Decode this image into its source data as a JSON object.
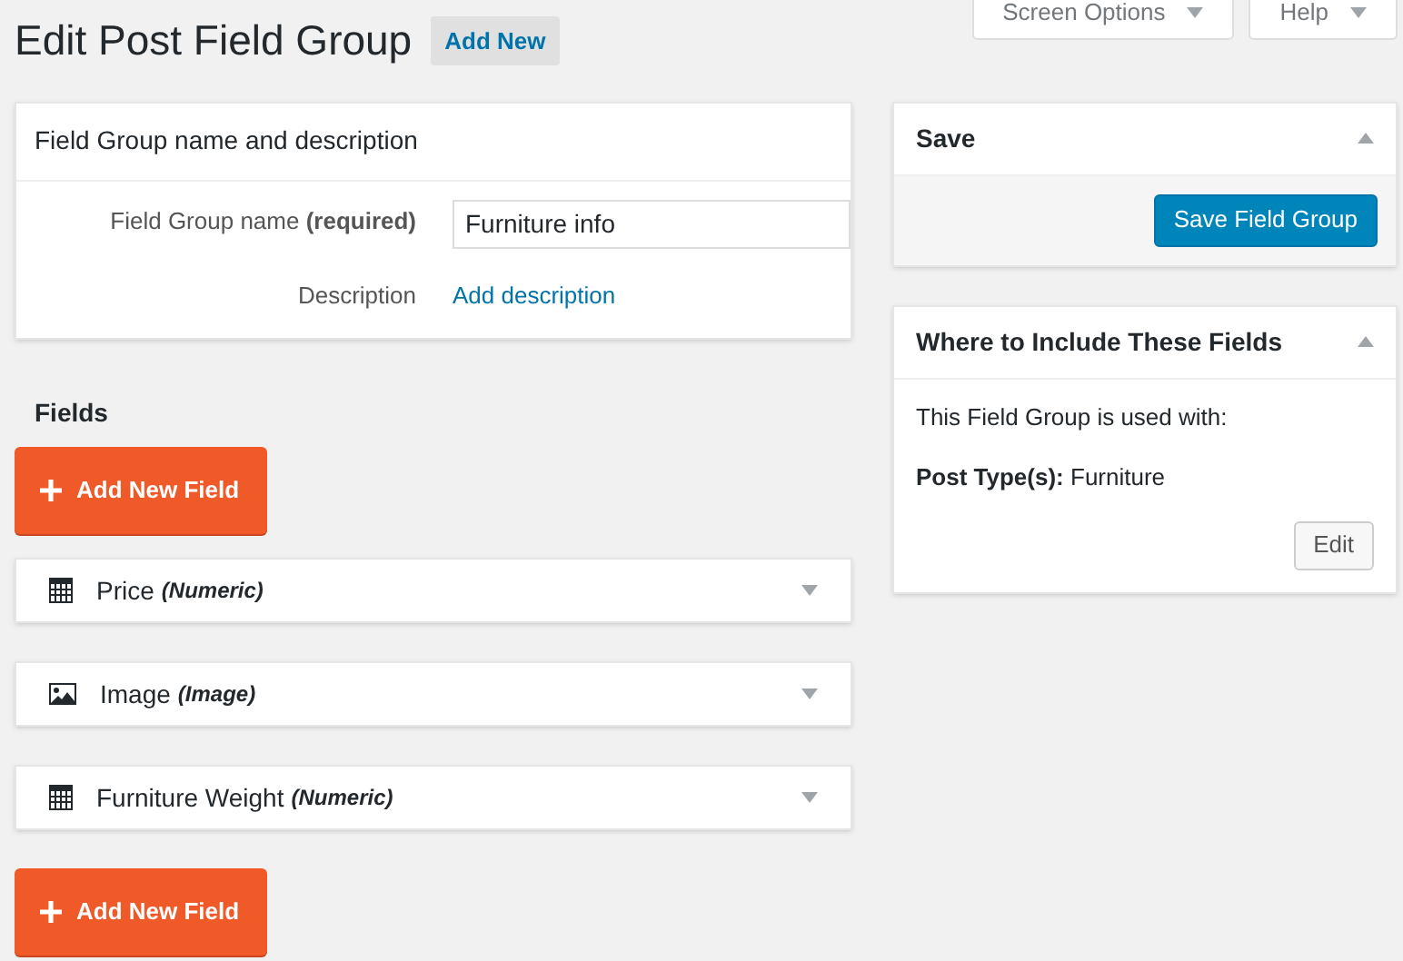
{
  "header": {
    "title": "Edit Post Field Group",
    "add_new": "Add New",
    "screen_options": "Screen Options",
    "help": "Help"
  },
  "group_box": {
    "title": "Field Group name and description",
    "name_label": "Field Group name **(required)**",
    "name_value": "Furniture info",
    "description_label": "Description",
    "description_link": "Add description"
  },
  "fields_heading": "Fields",
  "add_field_button": "Add New Field",
  "fields": [
    {
      "kind": "numeric",
      "name": "Price",
      "type": "(Numeric)"
    },
    {
      "kind": "image",
      "name": "Image",
      "type": "(Image)"
    },
    {
      "kind": "numeric",
      "name": "Furniture Weight",
      "type": "(Numeric)"
    }
  ],
  "add_field_button_bottom": "Add New Field",
  "save_box": {
    "title": "Save",
    "button": "Save Field Group"
  },
  "where_box": {
    "title": "Where to Include These Fields",
    "intro": "This Field Group is used with:",
    "rule": "**Post Type(s):** Furniture",
    "edit": "Edit"
  }
}
